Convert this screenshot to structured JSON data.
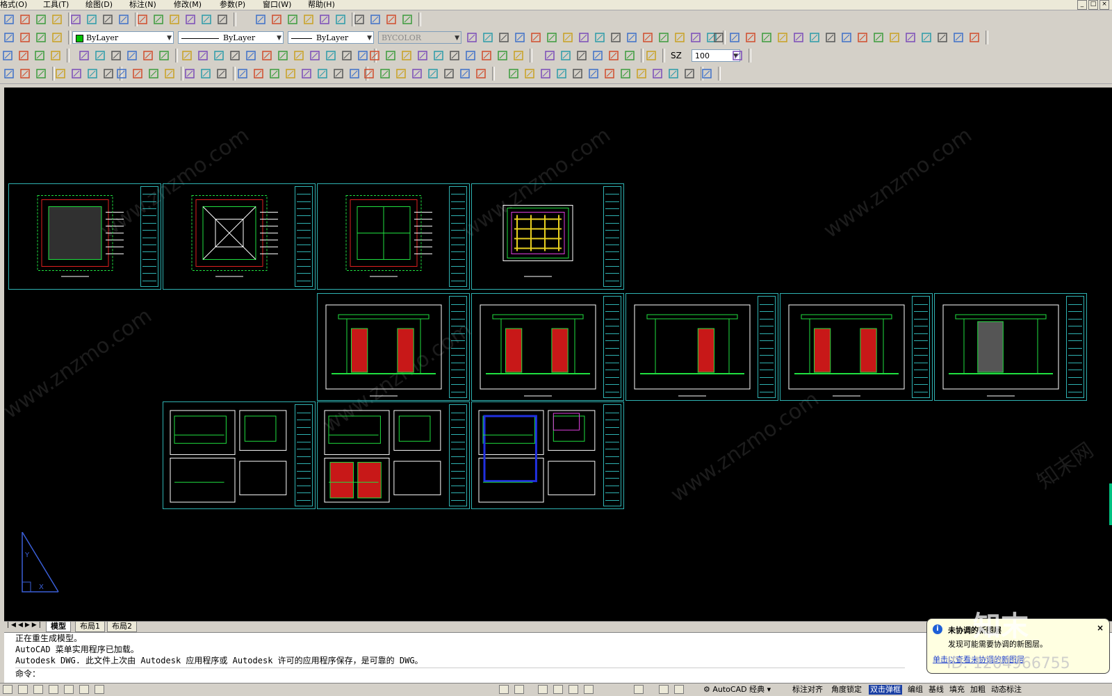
{
  "menu": {
    "items": [
      "格式(O)",
      "工具(T)",
      "绘图(D)",
      "标注(N)",
      "修改(M)",
      "参数(P)",
      "窗口(W)",
      "帮助(H)"
    ]
  },
  "window_controls": [
    "_",
    "□",
    "×"
  ],
  "properties_toolbar": {
    "color": "ByLayer",
    "linetype": "ByLayer",
    "lineweight": "ByLayer",
    "plotstyle": "BYCOLOR"
  },
  "styles_toolbar": {
    "text_style": "SZ",
    "scale": "100"
  },
  "drawing": {
    "watermark_text": "www.znzmo.com",
    "watermark_cn": "知末网"
  },
  "layout_tabs": [
    "模型",
    "布局1",
    "布局2"
  ],
  "command_window": {
    "history": [
      "正在重生成模型。",
      "AutoCAD 菜单实用程序已加载。",
      "Autodesk DWG.   此文件上次由 Autodesk 应用程序或 Autodesk 许可的应用程序保存，是可靠的 DWG。"
    ],
    "prompt": "命令："
  },
  "status_bar": {
    "workspace": "AutoCAD 经典",
    "items": [
      "标注对齐",
      "角度锁定",
      "双击弹框",
      "编组",
      "基线",
      "填充",
      "加粗",
      "动态标注"
    ],
    "active_item": "双击弹框"
  },
  "notification": {
    "title": "未协调的新图层",
    "body": "发现可能需要协调的新图层。",
    "link": "单击以查看未协调的新图层",
    "brand": "知末",
    "id_text": "ID: 1204966755"
  },
  "colors": {
    "canvas": "#000000",
    "sheet_border": "#2fb3b3",
    "ui_face": "#d4d0c8",
    "active_status": "#1a3fa3"
  }
}
